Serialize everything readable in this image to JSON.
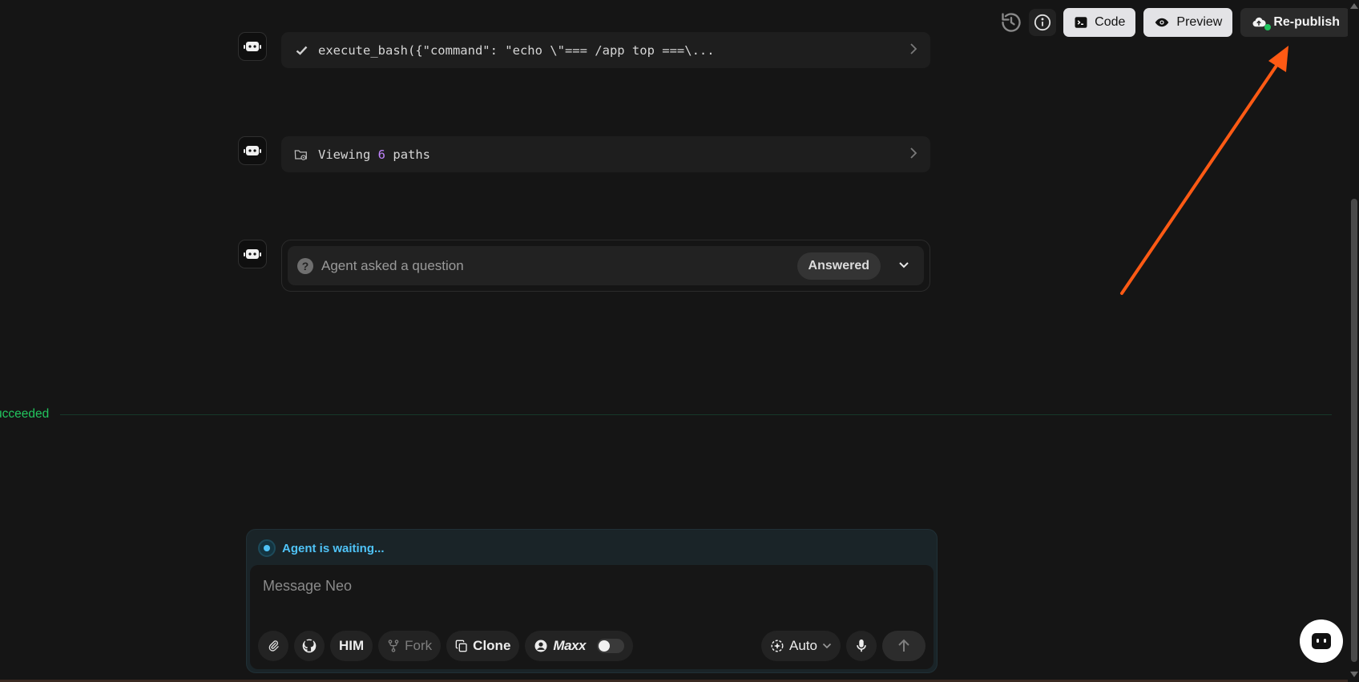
{
  "toolbar": {
    "code_label": "Code",
    "preview_label": "Preview",
    "republish_label": "Re-publish"
  },
  "chat": {
    "tool_call_1": "execute_bash({\"command\": \"echo \\\"=== /app top ===\\...",
    "viewing": {
      "prefix": "Viewing",
      "count": "6",
      "suffix": "paths"
    },
    "question": {
      "text": "Agent asked a question",
      "badge": "Answered"
    }
  },
  "status": {
    "text": "ucceeded",
    "color": "#22c55e"
  },
  "composer": {
    "waiting_text": "Agent is waiting...",
    "placeholder": "Message Neo",
    "him_label": "HIM",
    "fork_label": "Fork",
    "clone_label": "Clone",
    "maxx_label": "Maxx",
    "mode_label": "Auto"
  },
  "colors": {
    "background": "#151515",
    "accent_cyan": "#4fc3f7",
    "annotation_arrow": "#ff5a14",
    "success_green": "#22c55e"
  }
}
